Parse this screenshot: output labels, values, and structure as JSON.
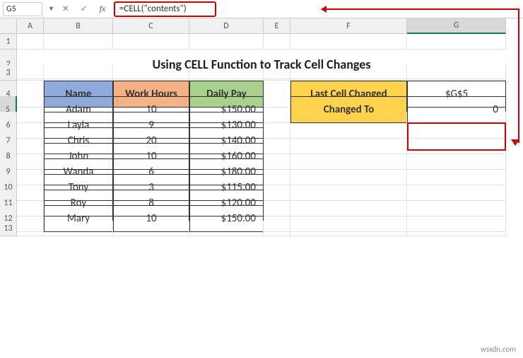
{
  "name_box": "G5",
  "formula": "=CELL(\"contents\")",
  "columns": [
    "A",
    "B",
    "C",
    "D",
    "E",
    "F",
    "G"
  ],
  "rows": [
    "1",
    "2",
    "3",
    "4",
    "5",
    "6",
    "7",
    "8",
    "9",
    "10",
    "11",
    "12",
    "13"
  ],
  "title": "Using CELL Function to Track Cell Changes",
  "headers": {
    "name": "Name",
    "hours": "Work Hours",
    "pay": "Daily Pay"
  },
  "side": {
    "last_label": "Last Cell Changed",
    "last_value": "$G$5",
    "changed_label": "Changed To",
    "changed_value": "0"
  },
  "table": [
    {
      "name": "Adam",
      "hours": "10",
      "pay": "$150.00"
    },
    {
      "name": "Layla",
      "hours": "9",
      "pay": "$130.00"
    },
    {
      "name": "Chris",
      "hours": "20",
      "pay": "$140.00"
    },
    {
      "name": "John",
      "hours": "10",
      "pay": "$160.00"
    },
    {
      "name": "Wanda",
      "hours": "6",
      "pay": "$180.00"
    },
    {
      "name": "Tony",
      "hours": "3",
      "pay": "$115.00"
    },
    {
      "name": "Roy",
      "hours": "8",
      "pay": "$120.00"
    },
    {
      "name": "Mary",
      "hours": "10",
      "pay": "$150.00"
    }
  ],
  "watermark": "wsxdn.com",
  "chart_data": {
    "type": "table",
    "title": "Using CELL Function to Track Cell Changes",
    "columns": [
      "Name",
      "Work Hours",
      "Daily Pay"
    ],
    "rows": [
      [
        "Adam",
        10,
        150.0
      ],
      [
        "Layla",
        9,
        130.0
      ],
      [
        "Chris",
        20,
        140.0
      ],
      [
        "John",
        10,
        160.0
      ],
      [
        "Wanda",
        6,
        180.0
      ],
      [
        "Tony",
        3,
        115.0
      ],
      [
        "Roy",
        8,
        120.0
      ],
      [
        "Mary",
        10,
        150.0
      ]
    ],
    "tracking": {
      "Last Cell Changed": "$G$5",
      "Changed To": 0
    }
  }
}
